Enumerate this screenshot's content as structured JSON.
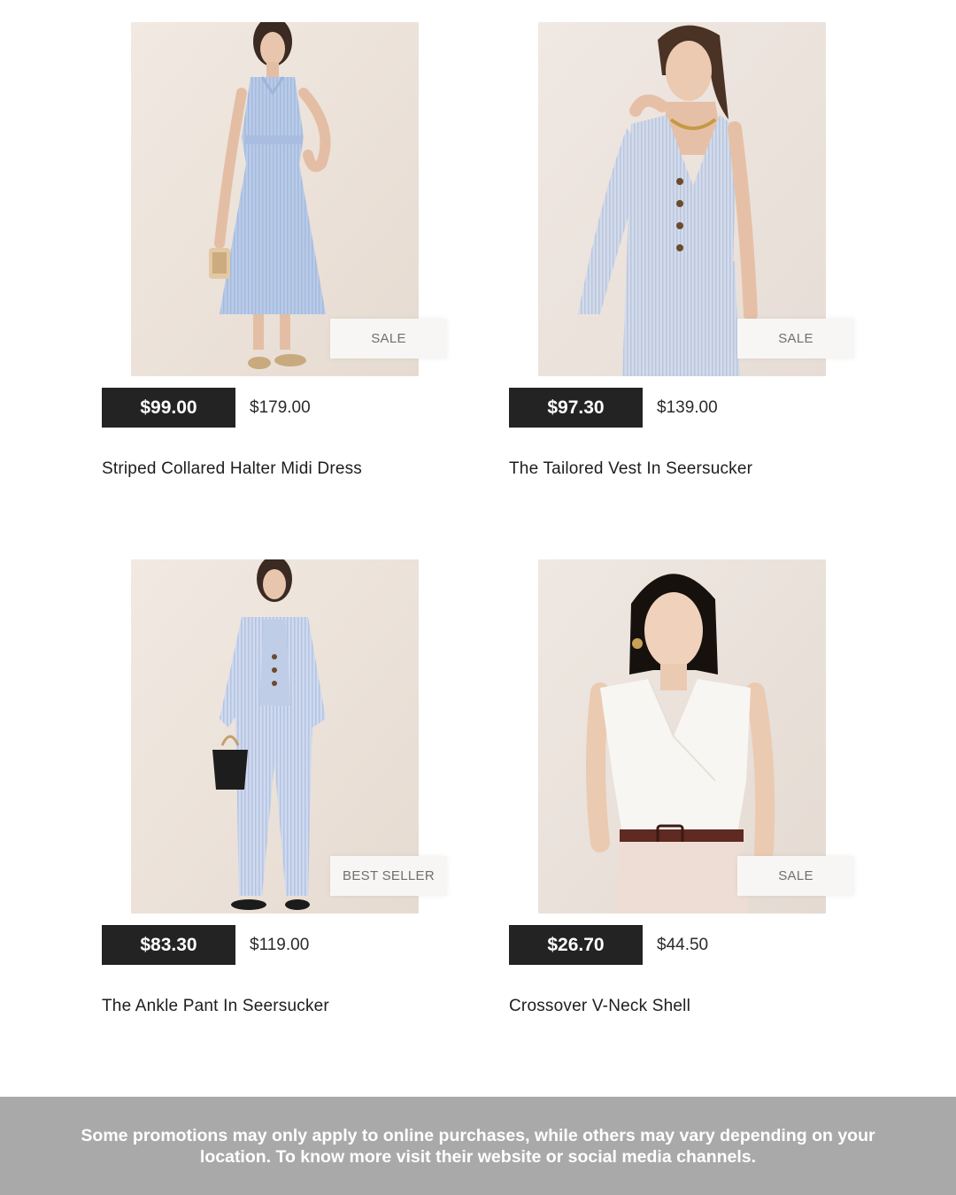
{
  "products": [
    {
      "badge": "SALE",
      "sale_price": "$99.00",
      "original_price": "$179.00",
      "name": "Striped Collared Halter Midi Dress",
      "image": "model-blue-striped-midi-dress"
    },
    {
      "badge": "SALE",
      "sale_price": "$97.30",
      "original_price": "$139.00",
      "name": "The Tailored Vest In Seersucker",
      "image": "model-seersucker-vest"
    },
    {
      "badge": "BEST SELLER",
      "sale_price": "$83.30",
      "original_price": "$119.00",
      "name": "The Ankle Pant In Seersucker",
      "image": "model-seersucker-suit"
    },
    {
      "badge": "SALE",
      "sale_price": "$26.70",
      "original_price": "$44.50",
      "name": "Crossover V-Neck Shell",
      "image": "model-white-vneck-shell"
    }
  ],
  "footer": {
    "disclaimer": "Some promotions may only apply to online purchases, while others may vary depending on your location. To know more visit their website or social media channels."
  },
  "colors": {
    "price_tag_bg": "#232323",
    "badge_bg": "#f7f6f4",
    "footer_bg": "#a9a9a9"
  }
}
